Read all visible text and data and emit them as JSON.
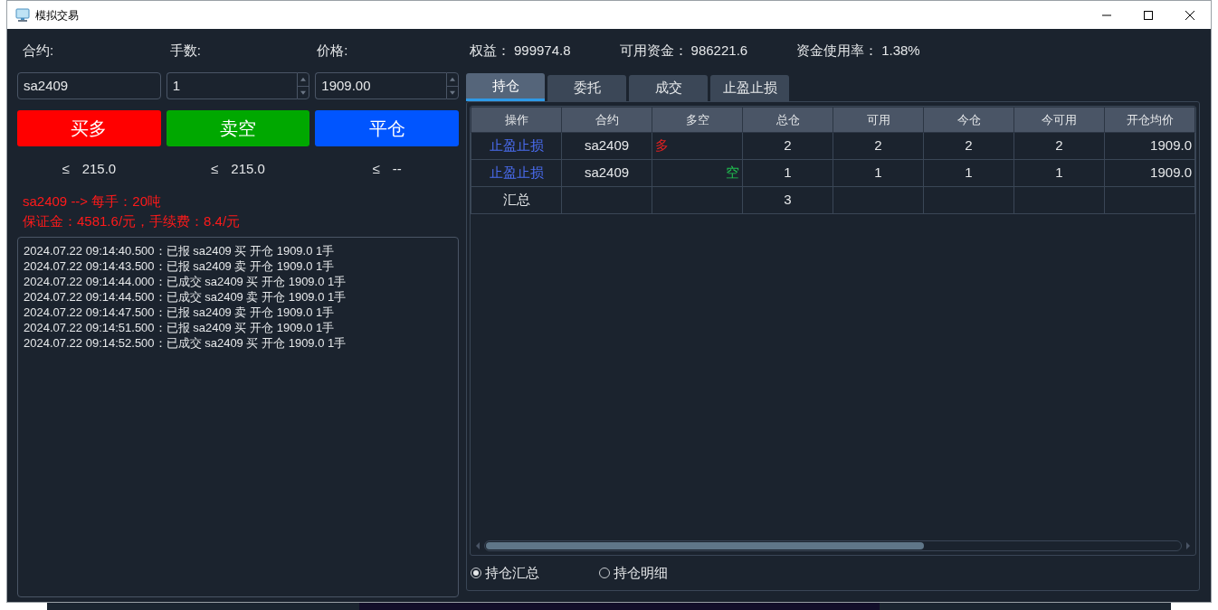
{
  "window": {
    "title": "模拟交易"
  },
  "order_form": {
    "labels": [
      "合约:",
      "手数:",
      "价格:"
    ],
    "contract": {
      "value": "sa2409"
    },
    "lots": {
      "value": "1"
    },
    "price": {
      "value": "1909.00"
    },
    "buttons": [
      {
        "label": "买多",
        "color": "#ff0000"
      },
      {
        "label": "卖空",
        "color": "#00a800"
      },
      {
        "label": "平仓",
        "color": "#0055ff"
      }
    ],
    "limits": [
      {
        "sign": "≤",
        "value": "215.0"
      },
      {
        "sign": "≤",
        "value": "215.0"
      },
      {
        "sign": "≤",
        "value": "--"
      }
    ],
    "info": [
      "sa2409 --> 每手：20吨",
      "保证金：4581.6/元，手续费：8.4/元"
    ]
  },
  "log": [
    "2024.07.22 09:14:40.500：已报 sa2409 买 开仓 1909.0 1手",
    "2024.07.22 09:14:43.500：已报 sa2409 卖 开仓 1909.0 1手",
    "2024.07.22 09:14:44.000：已成交 sa2409 买 开仓 1909.0 1手",
    "2024.07.22 09:14:44.500：已成交 sa2409 卖 开仓 1909.0 1手",
    "2024.07.22 09:14:47.500：已报 sa2409 卖 开仓 1909.0 1手",
    "2024.07.22 09:14:51.500：已报 sa2409 买 开仓 1909.0 1手",
    "2024.07.22 09:14:52.500：已成交 sa2409 买 开仓 1909.0 1手"
  ],
  "account": [
    {
      "label": "权益：",
      "value": "999974.8"
    },
    {
      "label": "可用资金：",
      "value": "986221.6"
    },
    {
      "label": "资金使用率：",
      "value": "1.38%"
    }
  ],
  "tabs": [
    {
      "label": "持仓",
      "selected": true
    },
    {
      "label": "委托",
      "selected": false
    },
    {
      "label": "成交",
      "selected": false
    },
    {
      "label": "止盈止损",
      "selected": false
    }
  ],
  "table": {
    "columns": [
      "操作",
      "合约",
      "多空",
      "总仓",
      "可用",
      "今仓",
      "今可用",
      "开仓均价"
    ],
    "rows": [
      {
        "kind": "long",
        "cells": [
          "止盈止损",
          "sa2409",
          "多",
          "2",
          "2",
          "2",
          "2",
          "1909.0"
        ]
      },
      {
        "kind": "short",
        "cells": [
          "止盈止损",
          "sa2409",
          "空",
          "1",
          "1",
          "1",
          "1",
          "1909.0"
        ]
      },
      {
        "kind": "total",
        "cells": [
          "汇总",
          "",
          "",
          "3",
          "",
          "",
          "",
          ""
        ]
      }
    ]
  },
  "view_options": [
    {
      "label": "持仓汇总",
      "selected": true
    },
    {
      "label": "持仓明细",
      "selected": false
    }
  ]
}
